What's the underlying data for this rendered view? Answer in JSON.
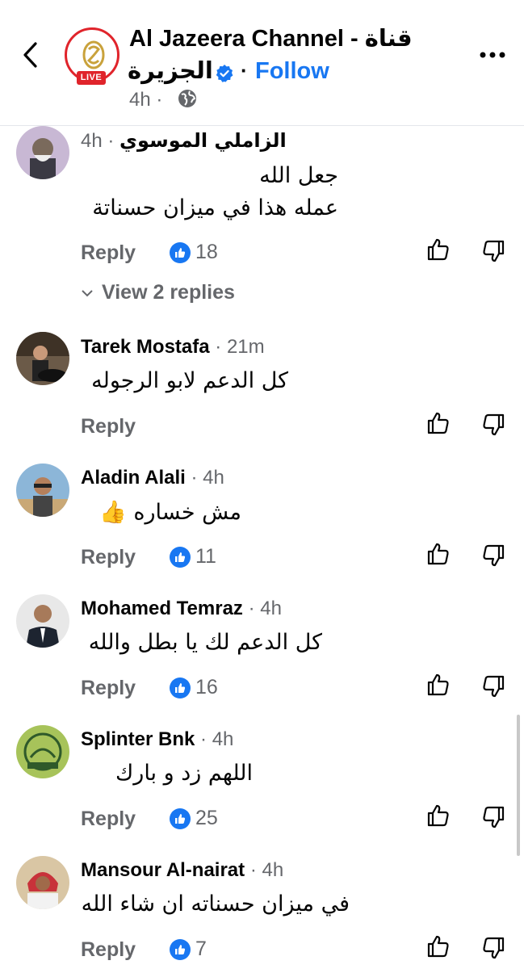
{
  "header": {
    "page_name_en": "Al Jazeera Channel - قناة",
    "page_name_ar": "الجزيرة",
    "follow_label": "Follow",
    "separator": "·",
    "post_time": "4h",
    "live_badge": "LIVE",
    "icons": [
      "back-arrow-icon",
      "verified-badge-icon",
      "globe-icon",
      "more-options-icon"
    ],
    "colors": {
      "brand_red": "#e0242b",
      "follow_blue": "#1877f2"
    }
  },
  "comments": [
    {
      "name": "الزاملي  الموسوي",
      "time": "4h",
      "body_line1": "جعل الله",
      "body_line2": "عمله هذا في ميزان حسناتة",
      "reply_label": "Reply",
      "likes": "18",
      "view_replies": "View 2 replies"
    },
    {
      "name": "Tarek Mostafa",
      "time": "21m",
      "body_line1": "كل الدعم لابو الرجوله",
      "reply_label": "Reply",
      "likes": ""
    },
    {
      "name": "Aladin Alali",
      "time": "4h",
      "body_line1": "مش خساره 👍",
      "reply_label": "Reply",
      "likes": "11"
    },
    {
      "name": "Mohamed Temraz",
      "time": "4h",
      "body_line1": "كل الدعم لك يا بطل والله",
      "reply_label": "Reply",
      "likes": "16"
    },
    {
      "name": "Splinter Bnk",
      "time": "4h",
      "body_line1": "اللهم زد و بارك",
      "reply_label": "Reply",
      "likes": "25"
    },
    {
      "name": "Mansour Al-nairat",
      "time": "4h",
      "body_line1": "في ميزان حسناته ان شاء الله",
      "reply_label": "Reply",
      "likes": "7"
    }
  ]
}
